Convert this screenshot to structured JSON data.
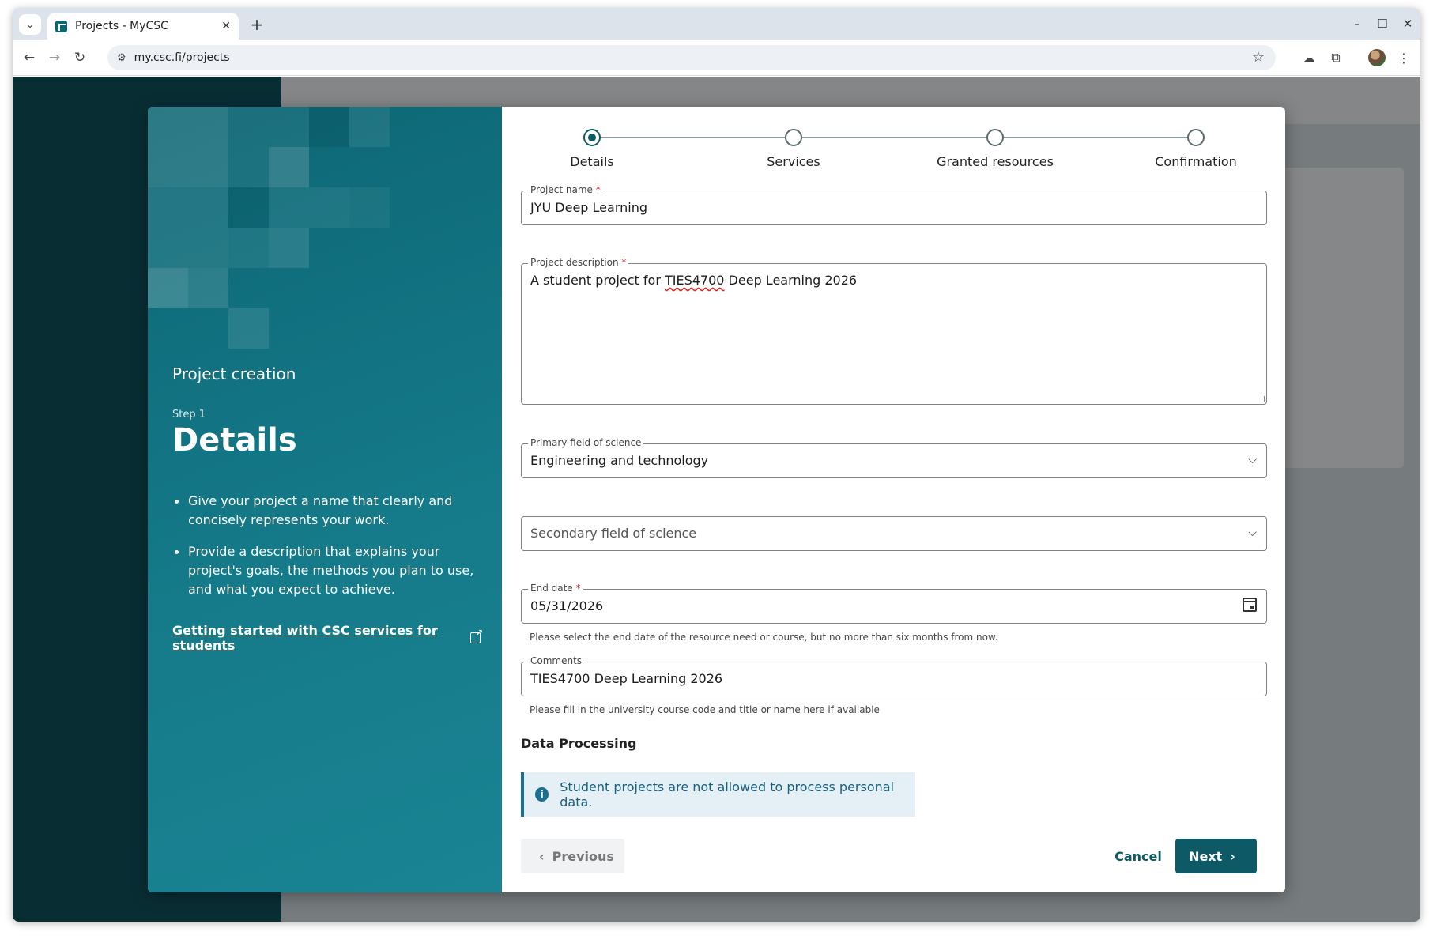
{
  "browser": {
    "tab_title": "Projects - MyCSC",
    "url": "my.csc.fi/projects",
    "icons": [
      "tab-search-icon",
      "close-icon",
      "new-tab-icon",
      "minimize-icon",
      "maximize-icon",
      "window-close-icon",
      "back-icon",
      "forward-icon",
      "reload-icon",
      "site-info-icon",
      "bookmark-star-icon",
      "cloud-icon",
      "extensions-icon",
      "profile-avatar",
      "menu-icon"
    ]
  },
  "left_panel": {
    "heading": "Project creation",
    "step_label": "Step 1",
    "step_title": "Details",
    "tips": [
      "Give your project a name that clearly and concisely represents your work.",
      "Provide a description that explains your project's goals, the methods you plan to use, and what you expect to achieve."
    ],
    "link": "Getting started with CSC services for students"
  },
  "stepper": {
    "steps": [
      "Details",
      "Services",
      "Granted resources",
      "Confirmation"
    ],
    "active_index": 0
  },
  "form": {
    "project_name": {
      "label": "Project name",
      "required_mark": "*",
      "value": "JYU Deep Learning"
    },
    "project_description": {
      "label": "Project description",
      "required_mark": "*",
      "value_prefix": "A student project for ",
      "value_misspelled": "TIES4700",
      "value_suffix": " Deep Learning 2026"
    },
    "primary_field": {
      "label": "Primary field of science",
      "value": "Engineering and technology"
    },
    "secondary_field": {
      "placeholder": "Secondary field of science"
    },
    "end_date": {
      "label": "End date",
      "required_mark": "*",
      "value": "05/31/2026",
      "helper": "Please select the end date of the resource need or course, but no more than six months from now."
    },
    "comments": {
      "label": "Comments",
      "value": "TIES4700 Deep Learning 2026",
      "helper": "Please fill in the university course code and title or name here if available"
    }
  },
  "data_processing": {
    "title": "Data Processing",
    "info": "Student projects are not allowed to process personal data."
  },
  "buttons": {
    "previous": "Previous",
    "cancel": "Cancel",
    "next": "Next"
  },
  "colors": {
    "primary": "#0d5a66",
    "panel": "#157a89",
    "info_bg": "#e4f0f5",
    "required": "#c0262d"
  }
}
